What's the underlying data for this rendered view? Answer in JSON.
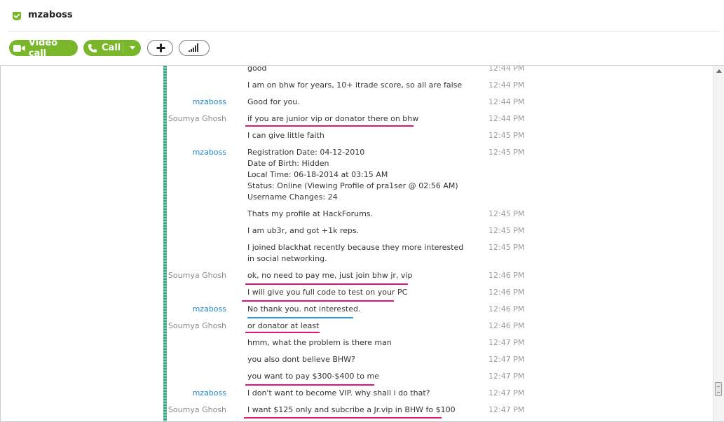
{
  "conversation": {
    "contact_name": "mzaboss",
    "presence_color": "#79b62a"
  },
  "toolbar": {
    "video_call_label": "Video call",
    "call_label": "Call",
    "accent_color": "#79b62a"
  },
  "messages": [
    {
      "sender": "",
      "text": "good",
      "time": "12:44 PM"
    },
    {
      "sender": "",
      "text": "I am on bhw for years, 10+ itrade score, so all are false",
      "time": "12:44 PM"
    },
    {
      "sender": "mzaboss",
      "text": "Good for you.",
      "time": "12:44 PM"
    },
    {
      "sender": "Soumya Ghosh",
      "text": "if you are junior vip or donator there on bhw",
      "time": "12:44 PM"
    },
    {
      "sender": "",
      "text": "I can give little faith",
      "time": "12:45 PM"
    },
    {
      "sender": "mzaboss",
      "lines": [
        "Registration Date: 04-12-2010",
        "Date of Birth: Hidden",
        "Local Time: 06-18-2014 at 03:15 AM",
        "Status: Online (Viewing Profile of pra1ser @ 02:56 AM)",
        "Username Changes: 24"
      ],
      "time": "12:45 PM"
    },
    {
      "sender": "",
      "text": "Thats my profile at HackForums.",
      "time": "12:45 PM"
    },
    {
      "sender": "",
      "text": "I am ub3r, and got +1k reps.",
      "time": "12:45 PM"
    },
    {
      "sender": "",
      "text": "I joined blackhat recently because they more interested in social networking.",
      "time": "12:45 PM"
    },
    {
      "sender": "Soumya Ghosh",
      "text": "ok, no need to pay me, just join bhw jr, vip",
      "time": "12:46 PM"
    },
    {
      "sender": "",
      "text": "I will give you full code to test on your PC",
      "time": "12:46 PM"
    },
    {
      "sender": "mzaboss",
      "text": "No thank you. not interested.",
      "time": "12:46 PM"
    },
    {
      "sender": "Soumya Ghosh",
      "text": "or donator at least",
      "time": "12:46 PM"
    },
    {
      "sender": "",
      "text": "hmm, what the problem is there man",
      "time": "12:47 PM"
    },
    {
      "sender": "",
      "text": "you also dont believe BHW?",
      "time": "12:47 PM"
    },
    {
      "sender": "",
      "text": "you want to pay $300-$400 to me",
      "time": "12:47 PM"
    },
    {
      "sender": "mzaboss",
      "text": "I don't want to become VIP. why shall i do that?",
      "time": "12:47 PM"
    },
    {
      "sender": "Soumya Ghosh",
      "text": "I want $125 only and subcribe a Jr.vip in BHW fo $100",
      "time": "12:47 PM"
    }
  ],
  "annotations": {
    "pink": "#e0147a",
    "blue": "#2a9be0"
  }
}
